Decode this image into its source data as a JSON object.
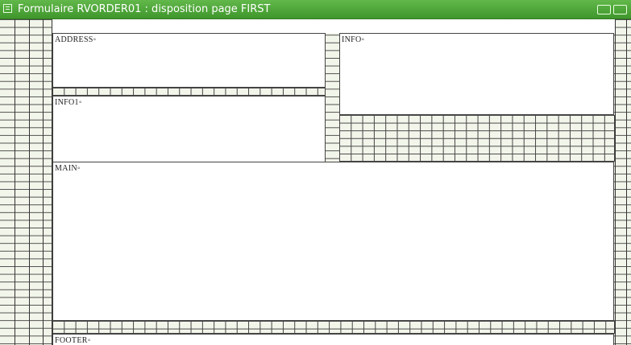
{
  "window": {
    "title": "Formulaire RVORDER01 : disposition page FIRST",
    "accent_color": "#4aa535",
    "icon": "form-icon"
  },
  "bands": {
    "address": "ADDRESS◦",
    "info": "INFO◦",
    "info1": "INFO1◦",
    "main": "MAIN◦",
    "footer": "FOOTER◦"
  }
}
